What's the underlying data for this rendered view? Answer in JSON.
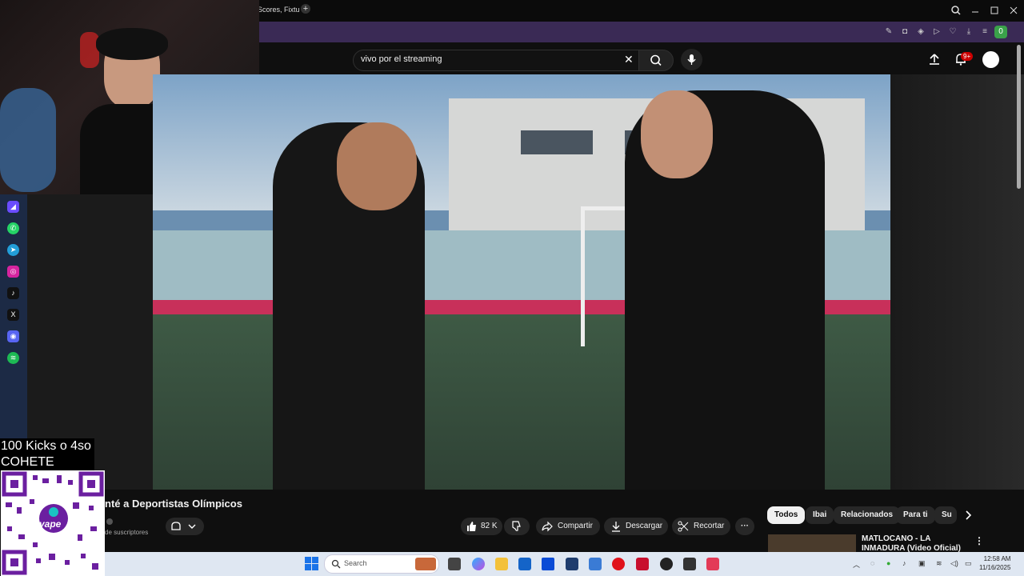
{
  "browser": {
    "tab_title": "Scores, Fixtu",
    "new_tab": "+",
    "profile_badge": "0"
  },
  "youtube": {
    "search_value": "vivo por el streaming",
    "notifications_badge": "9+",
    "video_title": "nté a Deportistas Olímpicos",
    "subscribers": "de suscriptores",
    "like_count": "82 K",
    "share_label": "Compartir",
    "download_label": "Descargar",
    "clip_label": "Recortar",
    "more_label": "···",
    "chips": [
      "Todos",
      "Ibai",
      "Relacionados",
      "Para ti",
      "Su"
    ],
    "reco_title": "MATLOCANO - LA INMADURA (Video Oficial)"
  },
  "overlay": {
    "kicks_line1": "100 Kicks o 4so",
    "kicks_line2": "COHETE",
    "qr_label": "yape"
  },
  "taskbar": {
    "search_placeholder": "Search",
    "time": "12:58 AM",
    "date": "11/16/2025"
  },
  "colors": {
    "youtube_bg": "#0f0f0f",
    "addressbar": "#3a2a55",
    "sidebar": "#1c2a45",
    "notification_red": "#cc0000",
    "taskbar": "#dfe7f2"
  },
  "icons": [
    "search-icon",
    "close-icon",
    "mic-icon",
    "upload-icon",
    "bell-icon",
    "like-icon",
    "dislike-icon",
    "share-icon",
    "download-icon",
    "scissors-icon",
    "windows-icon",
    "chevron-right-icon"
  ]
}
